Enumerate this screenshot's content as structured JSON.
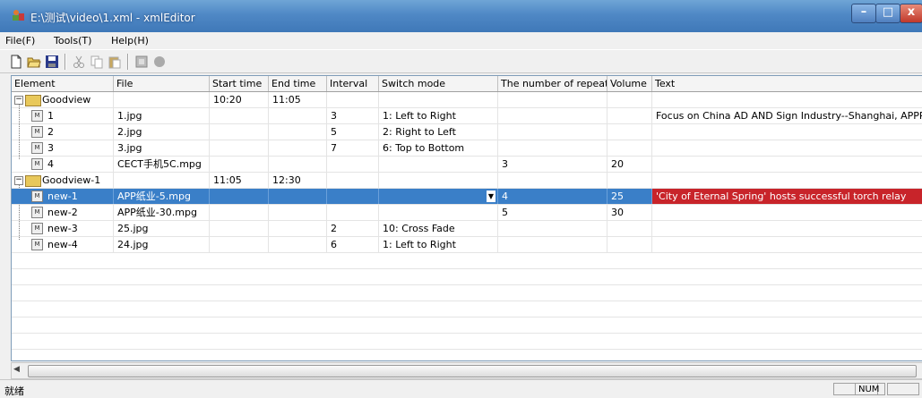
{
  "window": {
    "title": "E:\\测试\\video\\1.xml - xmlEditor",
    "minimize": "–",
    "maximize": "□",
    "close": "x",
    "title_bar_color": "#4f88c5",
    "close_color": "#c0392b"
  },
  "menu": [
    "File(F)",
    "Tools(T)",
    "Help(H)"
  ],
  "toolbar": {
    "icons": [
      "new-file-icon",
      "open-folder-icon",
      "save-icon",
      "cut-icon",
      "copy-icon",
      "paste-icon",
      "insert-icon",
      "record-icon"
    ]
  },
  "grid": {
    "columns": [
      "Element",
      "File",
      "Start time",
      "End time",
      "Interval",
      "Switch mode",
      "The number of repeat",
      "Volume",
      "Text"
    ],
    "rows": [
      {
        "element": "Goodview",
        "file": "",
        "start": "10:20",
        "end": "11:05",
        "interval": "",
        "mode": "",
        "repeat": "",
        "volume": "",
        "text": ""
      },
      {
        "element": "1",
        "file": "1.jpg",
        "start": "",
        "end": "",
        "interval": "3",
        "mode": "1: Left to Right",
        "repeat": "",
        "volume": "",
        "text": "Focus on China AD AND Sign Industry--Shanghai, APPPE..."
      },
      {
        "element": "2",
        "file": "2.jpg",
        "start": "",
        "end": "",
        "interval": "5",
        "mode": "2: Right to Left",
        "repeat": "",
        "volume": "",
        "text": ""
      },
      {
        "element": "3",
        "file": "3.jpg",
        "start": "",
        "end": "",
        "interval": "7",
        "mode": "6: Top to Bottom",
        "repeat": "",
        "volume": "",
        "text": ""
      },
      {
        "element": "4",
        "file": "CECT手机5C.mpg",
        "start": "",
        "end": "",
        "interval": "",
        "mode": "",
        "repeat": "3",
        "volume": "20",
        "text": ""
      },
      {
        "element": "Goodview-1",
        "file": "",
        "start": "11:05",
        "end": "12:30",
        "interval": "",
        "mode": "",
        "repeat": "",
        "volume": "",
        "text": ""
      },
      {
        "element": "new-1",
        "file": "APP纸业-5.mpg",
        "start": "",
        "end": "",
        "interval": "",
        "mode": "",
        "repeat": "4",
        "volume": "25",
        "text": "'City of Eternal Spring' hosts successful torch relay"
      },
      {
        "element": "new-2",
        "file": "APP纸业-30.mpg",
        "start": "",
        "end": "",
        "interval": "",
        "mode": "",
        "repeat": "5",
        "volume": "30",
        "text": ""
      },
      {
        "element": "new-3",
        "file": "25.jpg",
        "start": "",
        "end": "",
        "interval": "2",
        "mode": "10: Cross Fade",
        "repeat": "",
        "volume": "",
        "text": ""
      },
      {
        "element": "new-4",
        "file": "24.jpg",
        "start": "",
        "end": "",
        "interval": "6",
        "mode": "1: Left to Right",
        "repeat": "",
        "volume": "",
        "text": ""
      }
    ],
    "selected_row_color": "#3a7fc8",
    "highlight_text_color": "#c8242a"
  },
  "status": {
    "text": "就绪",
    "num": "NUM"
  }
}
